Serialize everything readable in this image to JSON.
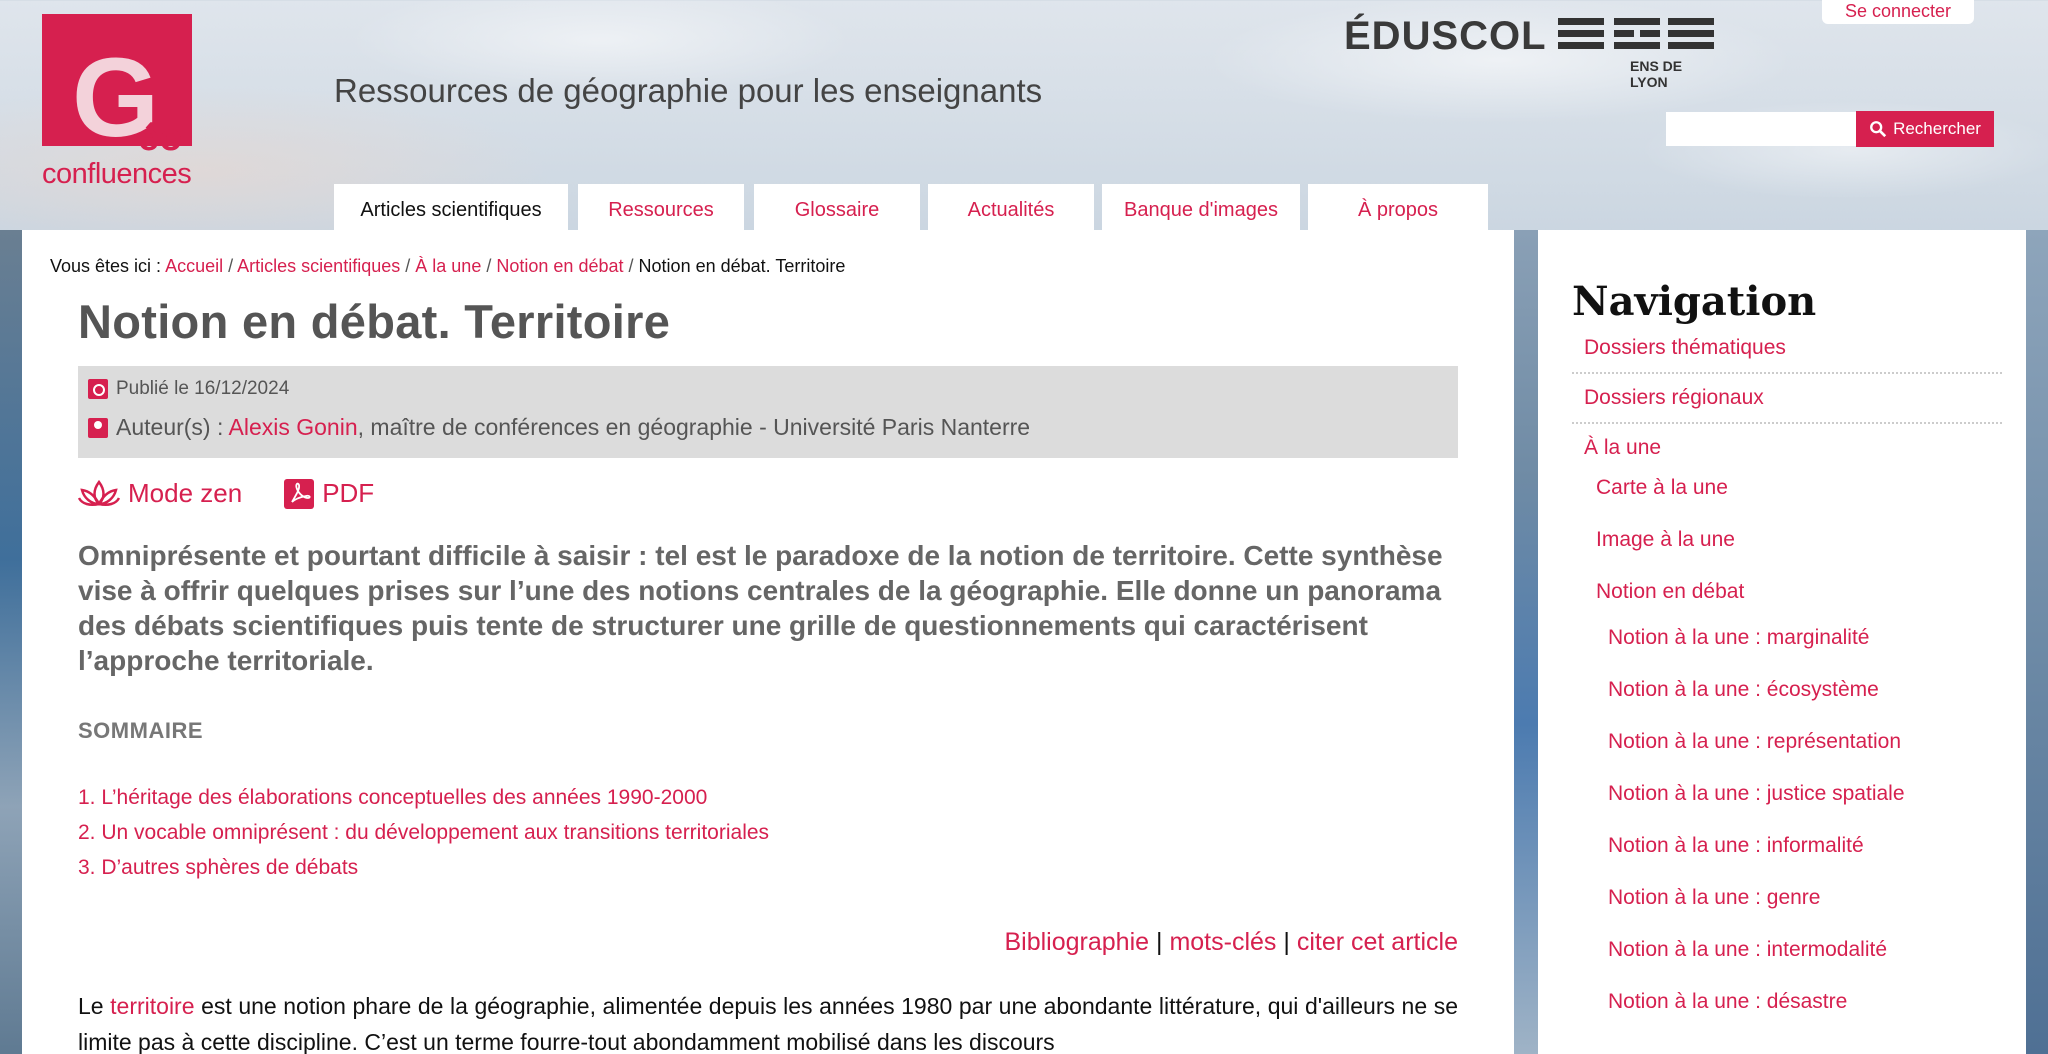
{
  "header": {
    "logo_main": "G",
    "logo_accent": "éo",
    "logo_sub": "confluences",
    "tagline": "Ressources de géographie pour les enseignants",
    "partner_eduscol": "ÉDUSCOL",
    "partner_ens": "ENS DE LYON",
    "login": "Se connecter",
    "search_placeholder": "",
    "search_button": "Rechercher"
  },
  "tabs": [
    {
      "label": "Articles scientifiques",
      "active": true
    },
    {
      "label": "Ressources"
    },
    {
      "label": "Glossaire"
    },
    {
      "label": "Actualités"
    },
    {
      "label": "Banque d'images"
    },
    {
      "label": "À propos"
    }
  ],
  "breadcrumb": {
    "prefix": "Vous êtes ici :",
    "items": [
      "Accueil",
      "Articles scientifiques",
      "À la une",
      "Notion en débat"
    ],
    "current": "Notion en débat. Territoire"
  },
  "article": {
    "title": "Notion en débat. Territoire",
    "published": "Publié le 16/12/2024",
    "authors_label": "Auteur(s) :",
    "author_name": "Alexis Gonin",
    "author_affiliation": ", maître de conférences en géographie - Université Paris Nanterre",
    "zen_mode": "Mode zen",
    "pdf": "PDF",
    "chapo": "Omniprésente et pourtant difficile à saisir : tel est le paradoxe de la notion de territoire. Cette synthèse vise à offrir quelques prises sur l’une des notions centrales de la géographie. Elle donne un panorama des débats scientifiques puis tente de structurer une grille de questionnements qui caractérisent l’approche territoriale.",
    "sommaire_title": "SOMMAIRE",
    "toc": [
      "1. L’héritage des élaborations conceptuelles des années 1990-2000",
      "2. Un vocable omniprésent : du développement aux transitions territoriales",
      "3. D’autres sphères de débats"
    ],
    "links": {
      "bibliography": "Bibliographie",
      "keywords": "mots-clés",
      "cite": "citer cet article",
      "separator": "|"
    },
    "body_intro": "Le",
    "body_link": "territoire",
    "body_rest": "est une notion phare de la géographie, alimentée depuis les années 1980 par une abondante littérature, qui d'ailleurs ne se limite pas à cette discipline. C’est un terme fourre-tout abondamment mobilisé dans les discours"
  },
  "sidebar": {
    "title": "Navigation",
    "items": [
      {
        "label": "Dossiers thématiques",
        "level": 1
      },
      {
        "label": "Dossiers régionaux",
        "level": 1
      },
      {
        "label": "À la une",
        "level": 1
      },
      {
        "label": "Carte à la une",
        "level": 2
      },
      {
        "label": "Image à la une",
        "level": 2
      },
      {
        "label": "Notion en débat",
        "level": 2
      },
      {
        "label": "Notion à la une : marginalité",
        "level": 3
      },
      {
        "label": "Notion à la une : écosystème",
        "level": 3
      },
      {
        "label": "Notion à la une : représentation",
        "level": 3
      },
      {
        "label": "Notion à la une : justice spatiale",
        "level": 3
      },
      {
        "label": "Notion à la une : informalité",
        "level": 3
      },
      {
        "label": "Notion à la une : genre",
        "level": 3
      },
      {
        "label": "Notion à la une : intermodalité",
        "level": 3
      },
      {
        "label": "Notion à la une : désastre",
        "level": 3
      }
    ]
  },
  "colors": {
    "accent": "#d6204f",
    "title_gray": "#555555",
    "meta_bg": "#dcdcdc"
  }
}
